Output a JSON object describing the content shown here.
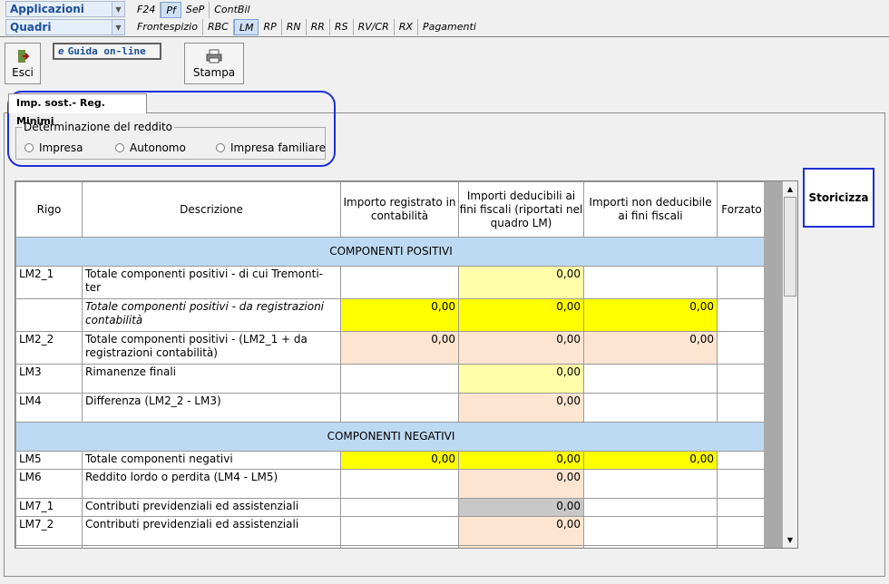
{
  "nav": {
    "applicazioni": "Applicazioni",
    "quadri": "Quadri",
    "row1": [
      "F24",
      "Pf",
      "SeP",
      "ContBil"
    ],
    "row1_selected": "Pf",
    "row2": [
      "Frontespizio",
      "RBC",
      "LM",
      "RP",
      "RN",
      "RR",
      "RS",
      "RV/CR",
      "RX",
      "Pagamenti"
    ],
    "row2_selected": "LM"
  },
  "toolbar": {
    "esci": "Esci",
    "guida": "Guida on-line",
    "stampa": "Stampa"
  },
  "tab": {
    "label": "Imp. sost.- Reg. Minimi"
  },
  "reddito": {
    "legend": "Determinazione del reddito",
    "options": [
      "Impresa",
      "Autonomo",
      "Impresa familiare"
    ]
  },
  "storicizza": "Storicizza",
  "table": {
    "headers": [
      "Rigo",
      "Descrizione",
      "Importo registrato in contabilità",
      "Importi deducibili ai fini fiscali (riportati nel quadro LM)",
      "Importi non deducibile ai fini fiscali",
      "Forzato"
    ],
    "section_pos": "COMPONENTI POSITIVI",
    "section_neg": "COMPONENTI NEGATIVI",
    "rows_pos": [
      {
        "rigo": "LM2_1",
        "desc": "Totale componenti positivi - di cui Tremonti-ter",
        "a": "",
        "b": "0,00",
        "c": ""
      },
      {
        "rigo": "",
        "desc": "Totale componenti positivi - da registrazioni contabilità",
        "a": "0,00",
        "b": "0,00",
        "c": "0,00"
      },
      {
        "rigo": "LM2_2",
        "desc": "Totale componenti positivi - (LM2_1 + da registrazioni contabilità)",
        "a": "0,00",
        "b": "0,00",
        "c": "0,00"
      },
      {
        "rigo": "LM3",
        "desc": "Rimanenze finali",
        "a": "",
        "b": "0,00",
        "c": ""
      },
      {
        "rigo": "LM4",
        "desc": "Differenza (LM2_2 - LM3)",
        "a": "",
        "b": "0,00",
        "c": ""
      }
    ],
    "rows_neg": [
      {
        "rigo": "LM5",
        "desc": "Totale componenti negativi",
        "a": "0,00",
        "b": "0,00",
        "c": "0,00"
      },
      {
        "rigo": "LM6",
        "desc": "Reddito lordo o perdita (LM4 - LM5)",
        "a": "",
        "b": "0,00",
        "c": ""
      },
      {
        "rigo": "LM7_1",
        "desc": "Contributi previdenziali ed assistenziali",
        "a": "",
        "b": "0,00",
        "c": ""
      },
      {
        "rigo": "LM7_2",
        "desc": "Contributi previdenziali ed assistenziali",
        "a": "",
        "b": "0,00",
        "c": ""
      }
    ]
  }
}
